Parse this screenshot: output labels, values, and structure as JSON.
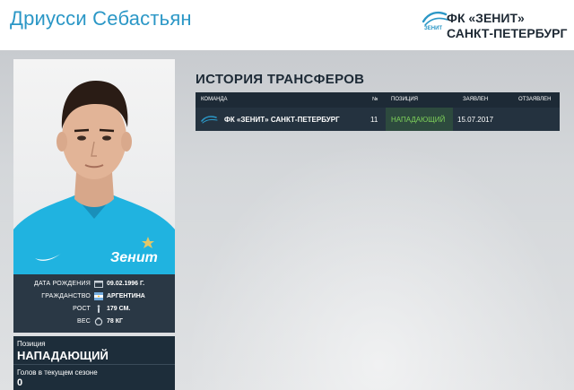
{
  "player": {
    "name": "Дриусси Себастьян"
  },
  "club": {
    "name_line1": "ФК «ЗЕНИТ»",
    "name_line2": "САНКТ-ПЕТЕРБУРГ",
    "logo_icon": "zenit-logo-icon"
  },
  "info": {
    "rows": [
      {
        "label": "ДАТА РОЖДЕНИЯ",
        "icon": "calendar-icon",
        "value": "09.02.1996 Г."
      },
      {
        "label": "ГРАЖДАНСТВО",
        "icon": "argentina-flag-icon",
        "value": "АРГЕНТИНА"
      },
      {
        "label": "РОСТ",
        "icon": "height-icon",
        "value": "179 СМ."
      },
      {
        "label": "ВЕС",
        "icon": "weight-icon",
        "value": "78 КГ"
      }
    ]
  },
  "position": {
    "label": "Позиция",
    "value": "НАПАДАЮЩИЙ",
    "goals_label": "Голов в текущем сезоне",
    "goals_value": "0"
  },
  "transfers": {
    "title": "ИСТОРИЯ ТРАНСФЕРОВ",
    "headers": [
      "КОМАНДА",
      "№",
      "ПОЗИЦИЯ",
      "ЗАЯВЛЕН",
      "ОТЗАЯВЛЕН"
    ],
    "rows": [
      {
        "team": "ФК «ЗЕНИТ» САНКТ-ПЕТЕРБУРГ",
        "number": "11",
        "position": "НАПАДАЮЩИЙ",
        "registered": "15.07.2017",
        "deregistered": ""
      }
    ]
  },
  "colors": {
    "accent": "#2b97c6",
    "position_text": "#7fd35a",
    "dark_panel": "#1d2a36"
  }
}
